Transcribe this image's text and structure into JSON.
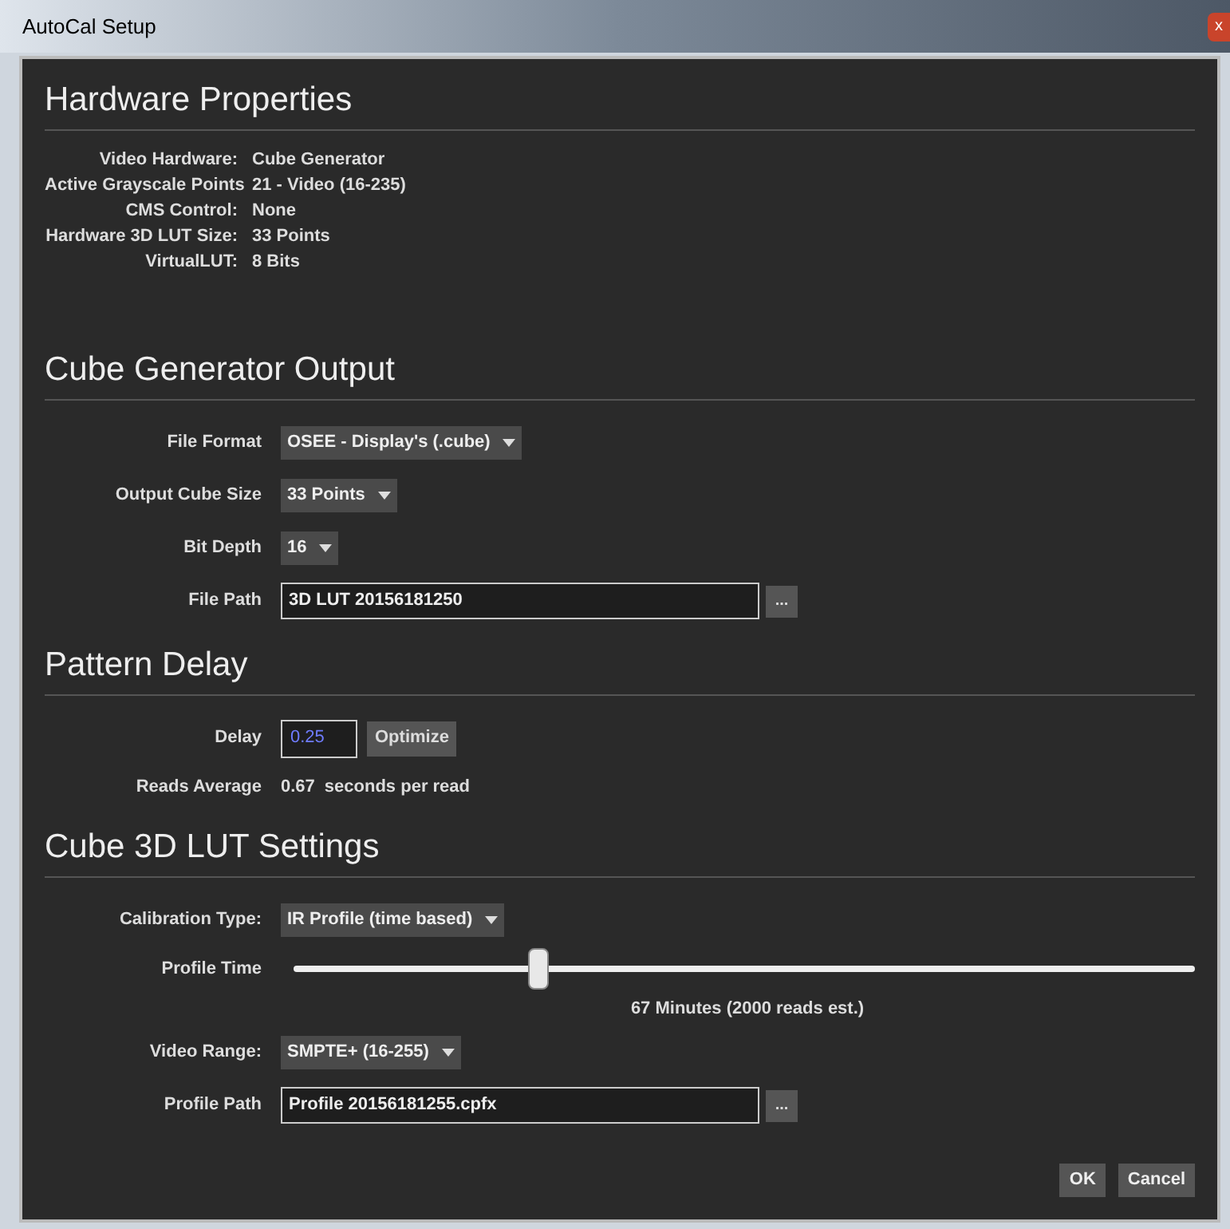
{
  "window": {
    "title": "AutoCal Setup",
    "close": "x"
  },
  "sections": [
    {
      "title": "Hardware Properties",
      "kind": "properties",
      "rows": [
        {
          "label": "Video Hardware:",
          "value": "Cube Generator"
        },
        {
          "label": "Active Grayscale Points",
          "value": "21 - Video (16-235)"
        },
        {
          "label": "CMS Control:",
          "value": "None"
        },
        {
          "label": "Hardware 3D LUT Size:",
          "value": "33 Points"
        },
        {
          "label": "VirtualLUT:",
          "value": "8 Bits"
        }
      ]
    },
    {
      "title": "Cube Generator Output",
      "kind": "form",
      "rows": [
        {
          "kind": "dropdown",
          "label": "File Format",
          "value": "OSEE - Display's (.cube)"
        },
        {
          "kind": "dropdown",
          "label": "Output Cube Size",
          "value": "33 Points"
        },
        {
          "kind": "dropdown",
          "label": "Bit Depth",
          "value": "16"
        },
        {
          "kind": "path",
          "label": "File Path",
          "value": "3D LUT 20156181250",
          "button": "..."
        }
      ]
    },
    {
      "title": "Pattern Delay",
      "kind": "form",
      "rows": [
        {
          "kind": "delay",
          "label": "Delay",
          "value": "0.25",
          "button": "Optimize"
        },
        {
          "kind": "text",
          "label": "Reads Average",
          "value": "0.67",
          "unit": "seconds per read"
        }
      ]
    },
    {
      "title": "Cube 3D LUT Settings",
      "kind": "form",
      "rows": [
        {
          "kind": "dropdown",
          "label": "Calibration Type:",
          "value": "IR Profile (time based)"
        },
        {
          "kind": "slider",
          "label": "Profile Time",
          "level": 0.27,
          "reading": "67 Minutes (2000 reads est.)"
        },
        {
          "kind": "dropdown",
          "label": "Video Range:",
          "value": "SMPTE+ (16-255)"
        },
        {
          "kind": "path",
          "label": "Profile Path",
          "value": "Profile 20156181255.cpfx",
          "button": "..."
        }
      ]
    }
  ],
  "buttons": [
    "OK",
    "Cancel"
  ]
}
